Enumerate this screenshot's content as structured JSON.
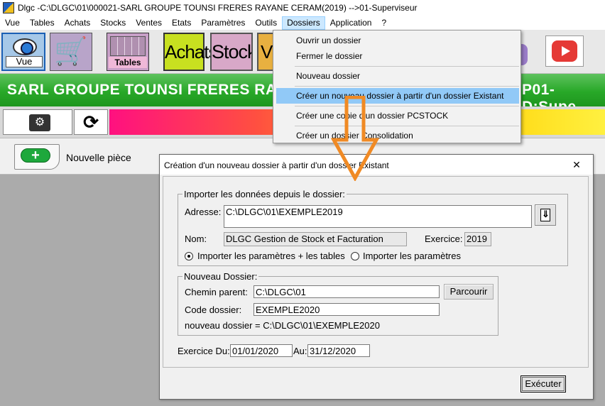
{
  "window": {
    "title": "Dlgc -C:\\DLGC\\01\\000021-SARL GROUPE TOUNSI FRERES RAYANE CERAM(2019) -->01-Superviseur"
  },
  "menubar": [
    "Vue",
    "Tables",
    "Achats",
    "Stocks",
    "Ventes",
    "Etats",
    "Paramètres",
    "Outils",
    "Dossiers",
    "Application",
    "?"
  ],
  "toolbar": {
    "vue_label": "Vue",
    "tables_label": "Tables",
    "achats_label": "Achats",
    "stocks_label": "Stocks",
    "ventes_partial": "Ve"
  },
  "banner": {
    "left": "SARL GROUPE TOUNSI FRERES RAY",
    "right": "P01-D:Supe"
  },
  "piece": {
    "add_label": "Nouvelle pièce"
  },
  "dossiers_menu": {
    "items": [
      "Ouvrir un dossier",
      "Fermer le dossier",
      "Nouveau dossier",
      "Créer un nouveau dossier  à partir d'un dossier Existant",
      "Créer une copie d'un dossier PCSTOCK",
      "Créer un dossier Consolidation"
    ],
    "highlighted_index": 3
  },
  "dialog": {
    "title": "Création d'un nouveau dossier à partir d'un dossier Existant",
    "import_group": {
      "legend": "Importer les données  depuis le dossier:",
      "adresse_label": "Adresse:",
      "adresse_value": "C:\\DLGC\\01\\EXEMPLE2019",
      "nom_label": "Nom:",
      "nom_value": "DLGC Gestion de Stock et Facturation",
      "exercice_label": "Exercice:",
      "exercice_value": "2019",
      "radio1_label": "Importer les paramètres + les tables",
      "radio2_label": "Importer les paramètres",
      "radio_selected": 1
    },
    "new_group": {
      "legend": "Nouveau Dossier:",
      "chemin_label": "Chemin parent:",
      "chemin_value": "C:\\DLGC\\01",
      "parcourir_label": "Parcourir",
      "code_label": "Code dossier:",
      "code_value": "EXEMPLE2020",
      "result_text": "nouveau dossier = C:\\DLGC\\01\\EXEMPLE2020"
    },
    "exercice_du_label": "Exercice Du:",
    "exercice_du_value": "01/01/2020",
    "au_label": "Au:",
    "au_value": "31/12/2020",
    "executer_label": "Exécuter"
  },
  "colors": {
    "banner_green": "#28a828",
    "menu_highlight": "#91c9f7",
    "arrow_orange": "#f08a24"
  }
}
